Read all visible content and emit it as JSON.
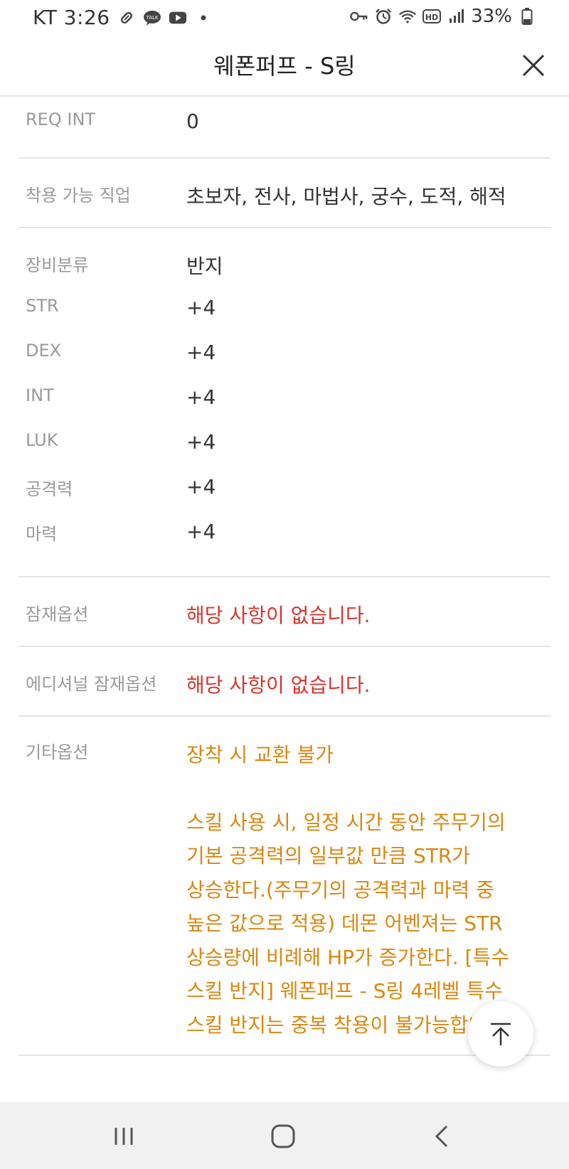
{
  "status_bar": {
    "carrier_time": "KT 3:26",
    "battery": "33%",
    "icons_left": [
      "pill-icon",
      "kakaotalk-icon",
      "youtube-icon",
      "dot-icon"
    ],
    "icons_right": [
      "key-icon",
      "alarm-icon",
      "wifi-icon",
      "hd-icon",
      "signal-icon",
      "battery-icon"
    ]
  },
  "header": {
    "title": "웨폰퍼프 - S링"
  },
  "details": {
    "req_int": {
      "label": "REQ INT",
      "value": "0"
    },
    "jobs": {
      "label": "착용 가능 직업",
      "value": "초보자, 전사, 마법사, 궁수, 도적, 해적"
    },
    "stats": [
      {
        "label": "장비분류",
        "value": "반지"
      },
      {
        "label": "STR",
        "value": "+4"
      },
      {
        "label": "DEX",
        "value": "+4"
      },
      {
        "label": "INT",
        "value": "+4"
      },
      {
        "label": "LUK",
        "value": "+4"
      },
      {
        "label": "공격력",
        "value": "+4"
      },
      {
        "label": "마력",
        "value": "+4"
      }
    ],
    "potential": {
      "label": "잠재옵션",
      "value": "해당 사항이 없습니다."
    },
    "additional_potential": {
      "label": "에디셔널 잠재옵션",
      "value": "해당 사항이 없습니다."
    },
    "etc": {
      "label": "기타옵션",
      "line1": "장착 시 교환 불가",
      "description_lines": [
        "스킬 사용 시, 일정 시간 동안 주무기의",
        "기본 공격력의 일부값 만큼 STR가",
        "상승한다.(주무기의 공격력과 마력 중",
        "높은 값으로 적용) 데몬 어벤져는 STR",
        "상승량에 비례해 HP가 증가한다. [특수",
        "스킬 반지] 웨폰퍼프 - S링 4레벨 특수",
        "스킬 반지는 중복 착용이 불가능합니다."
      ]
    }
  },
  "colors": {
    "label_gray": "#9a9a9a",
    "value_dark": "#333333",
    "red": "#d9332b",
    "orange": "#d9870f",
    "divider": "#e4e4e4",
    "navbar_bg": "#f1f1f1"
  }
}
